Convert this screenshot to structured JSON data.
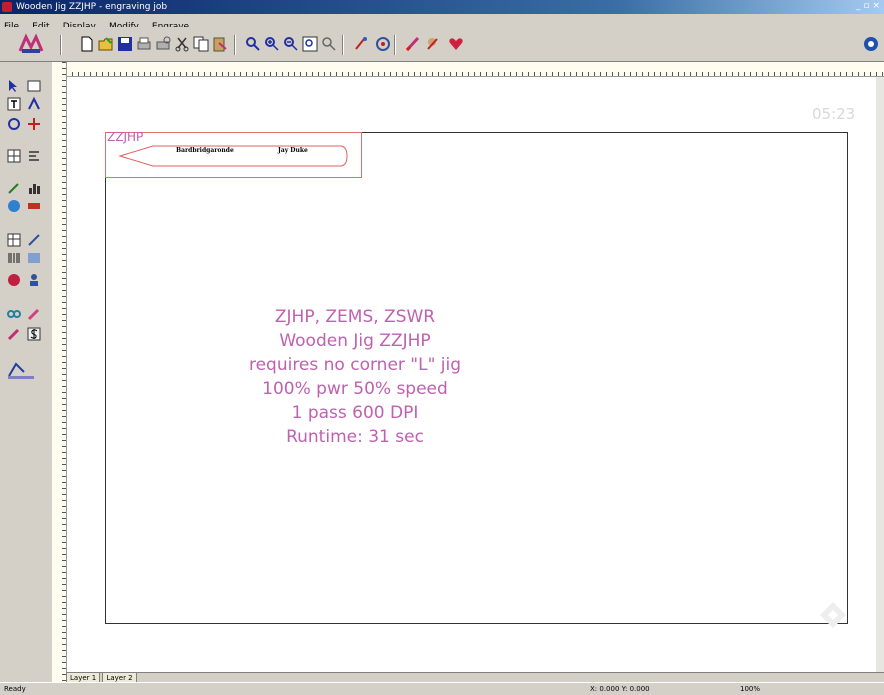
{
  "window": {
    "title": "Wooden Jig ZZJHP - engraving job"
  },
  "menu": {
    "items": [
      "File",
      "Edit",
      "Display",
      "Modify",
      "Engrave"
    ]
  },
  "canvas": {
    "timer": "05:23",
    "job_name": "ZZJHP",
    "engraving_left": "Bardbridgaronde",
    "engraving_right": "Jay Duke"
  },
  "notes": {
    "line1": "ZJHP, ZEMS, ZSWR",
    "line2": "Wooden Jig ZZJHP",
    "line3": "requires no corner \"L\" jig",
    "line4": "100% pwr    50% speed",
    "line5": "1 pass    600 DPI",
    "line6": "Runtime: 31 sec"
  },
  "tabs": {
    "layer1": "Layer 1",
    "layer2": "Layer 2"
  },
  "status": {
    "left": "Ready",
    "coords": "X: 0.000  Y: 0.000",
    "zoom": "100%"
  },
  "colors": {
    "accent": "#c060b0",
    "title_bar": "#0a246a",
    "outline": "#e07070"
  }
}
